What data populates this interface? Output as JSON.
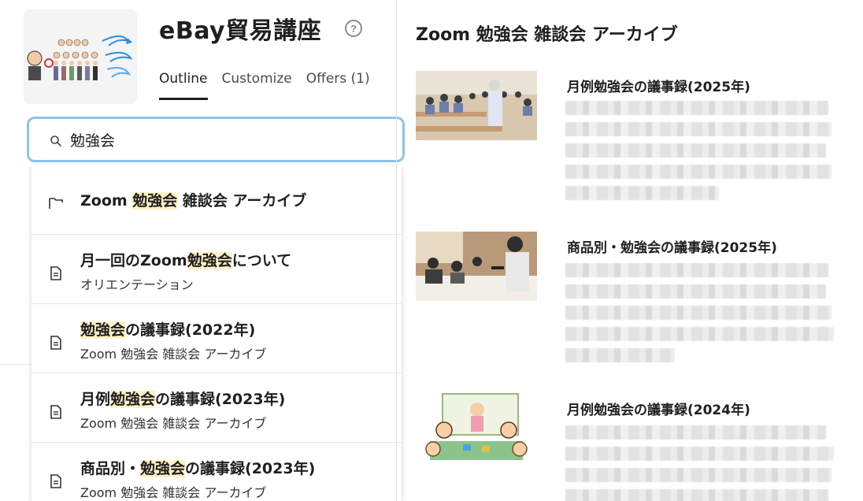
{
  "course": {
    "title": "eBay貿易講座",
    "help_glyph": "?"
  },
  "tabs": [
    {
      "label": "Outline",
      "active": true
    },
    {
      "label": "Customize",
      "active": false
    },
    {
      "label": "Offers (1)",
      "active": false
    }
  ],
  "search": {
    "value": "勉強会"
  },
  "results": [
    {
      "type": "folder-icon",
      "pre": "Zoom ",
      "hl": "勉強会",
      "post": " 雑談会 アーカイブ",
      "sub": ""
    },
    {
      "type": "document-icon",
      "pre": "月一回のZoom",
      "hl": "勉強会",
      "post": "について",
      "sub": "オリエンテーション"
    },
    {
      "type": "document-icon",
      "pre": "",
      "hl": "勉強会",
      "post": "の議事録(2022年)",
      "sub": "Zoom 勉強会 雑談会 アーカイブ"
    },
    {
      "type": "document-icon",
      "pre": "月例",
      "hl": "勉強会",
      "post": "の議事録(2023年)",
      "sub": "Zoom 勉強会 雑談会 アーカイブ"
    },
    {
      "type": "document-icon",
      "pre": "商品別・",
      "hl": "勉強会",
      "post": "の議事録(2023年)",
      "sub": "Zoom 勉強会 雑談会 アーカイブ"
    }
  ],
  "right": {
    "title": "Zoom 勉強会 雑談会 アーカイブ",
    "cards": [
      {
        "title": "月例勉強会の議事録(2025年)",
        "lines": [
          0.96,
          0.97,
          0.95,
          0.97,
          0.56
        ]
      },
      {
        "title": "商品別・勉強会の議事録(2025年)",
        "lines": [
          0.96,
          0.95,
          0.97,
          0.98,
          0.4
        ]
      },
      {
        "title": "月例勉強会の議事録(2024年)",
        "lines": [
          0.95,
          0.98,
          0.97,
          0.96
        ]
      }
    ]
  },
  "colors": {
    "search_border": "#8cc3ee",
    "highlight": "#fdf1c6",
    "tab_underline": "#1f1f1f"
  }
}
